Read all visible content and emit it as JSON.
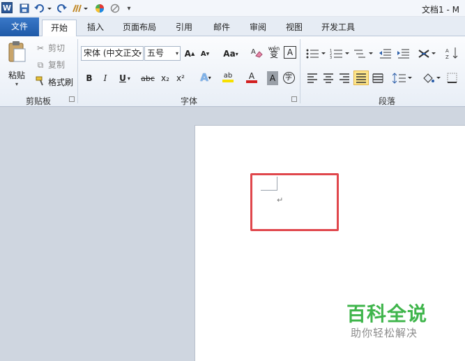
{
  "titlebar": {
    "logo": "W",
    "title": "文档1 - M",
    "icons": [
      "save-icon",
      "undo-icon",
      "redo-icon",
      "format-painter-icon",
      "color-wheel-icon",
      "clear-icon",
      "customize-icon"
    ]
  },
  "tabs": [
    {
      "label": "文件"
    },
    {
      "label": "开始"
    },
    {
      "label": "插入"
    },
    {
      "label": "页面布局"
    },
    {
      "label": "引用"
    },
    {
      "label": "邮件"
    },
    {
      "label": "审阅"
    },
    {
      "label": "视图"
    },
    {
      "label": "开发工具"
    }
  ],
  "clipboard": {
    "paste": "粘贴",
    "cut": "剪切",
    "copy": "复制",
    "format_painter": "格式刷",
    "group_label": "剪贴板"
  },
  "font": {
    "font_name": "宋体 (中文正文",
    "font_size": "五号",
    "group_label": "字体",
    "aa": "Aa",
    "bold": "B",
    "italic": "I",
    "underline": "U",
    "strike": "abc",
    "subscript": "x₂",
    "superscript": "x²",
    "clear_btn": "A",
    "grow": "A",
    "shrink": "A",
    "pinyin": "wén",
    "pinyin_char": "变",
    "border_char": "A",
    "highlight": "ab",
    "font_color": "A",
    "shade": "A",
    "enclose": "字"
  },
  "paragraph": {
    "group_label": "段落"
  },
  "watermark": {
    "title": "百科全说",
    "subtitle": "助你轻松解决"
  },
  "colors": {
    "file_tab": "#2b66b7",
    "highlight_box": "#e0474c",
    "watermark_green": "#3fb54b",
    "font_color_red": "#d21f1f",
    "highlight_yellow": "#f7e000"
  }
}
